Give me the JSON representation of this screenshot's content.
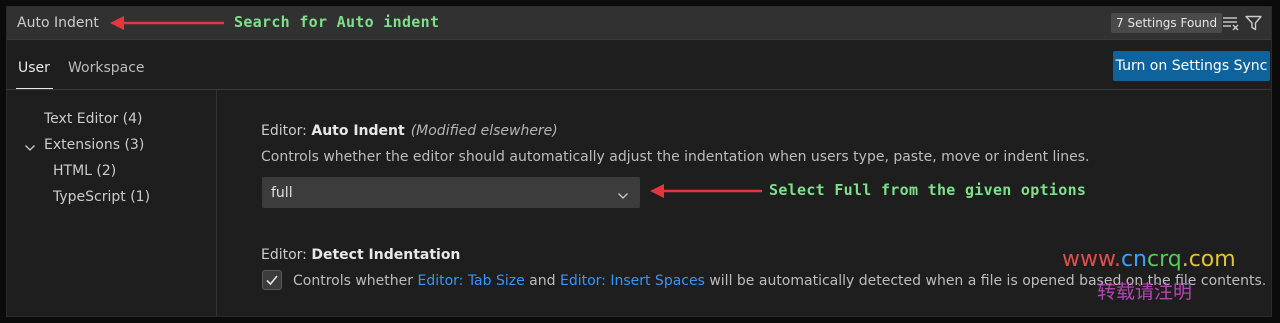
{
  "search": {
    "value": "Auto Indent",
    "results_badge": "7 Settings Found"
  },
  "annotations": {
    "search_tip": "Search for Auto indent",
    "select_tip": "Select Full from the given options",
    "arrow_color": "#e8343b",
    "text_color": "#7ee08a"
  },
  "tabs": [
    {
      "label": "User",
      "active": true
    },
    {
      "label": "Workspace",
      "active": false
    }
  ],
  "sync_button": {
    "label": "Turn on Settings Sync",
    "color": "#0e639c"
  },
  "sidebar": {
    "items": [
      {
        "label": "Text Editor (4)"
      },
      {
        "label": "Extensions (3)",
        "expanded": true
      },
      {
        "label": "HTML (2)"
      },
      {
        "label": "TypeScript (1)"
      }
    ]
  },
  "settings": {
    "auto_indent": {
      "prefix": "Editor: ",
      "name": "Auto Indent",
      "modified": "(Modified elsewhere)",
      "description": "Controls whether the editor should automatically adjust the indentation when users type, paste, move or indent lines.",
      "value": "full"
    },
    "detect_indentation": {
      "prefix": "Editor: ",
      "name": "Detect Indentation",
      "checked": true,
      "desc_part1": "Controls whether ",
      "link1": "Editor: Tab Size",
      "desc_part2": " and ",
      "link2": "Editor: Insert Spaces",
      "desc_part3": " will be automatically detected when a file is opened based on the file contents."
    }
  },
  "watermark": {
    "line1_a": "www.",
    "line1_b": "cn",
    "line1_c": "crq",
    "line1_d": ".com",
    "line2": "转载请注明"
  }
}
